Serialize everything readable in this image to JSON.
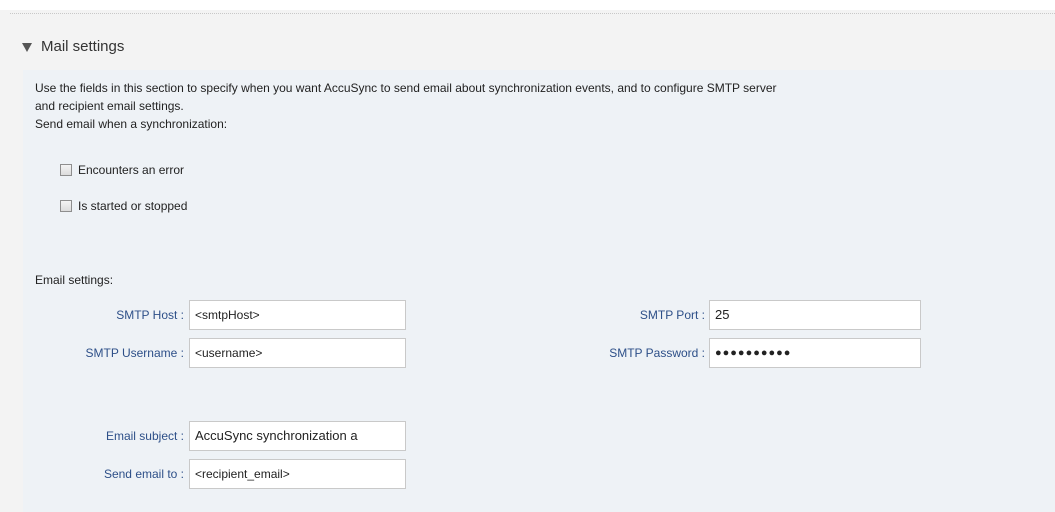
{
  "section": {
    "title": "Mail settings"
  },
  "description": {
    "line1": "Use the fields in this section to specify when you want AccuSync to send email about synchronization events, and to configure SMTP server",
    "line2": "and recipient email settings.",
    "send_when": "Send email when a synchronization:"
  },
  "triggers": [
    {
      "label": "Encounters an error",
      "checked": false
    },
    {
      "label": "Is started or stopped",
      "checked": false
    }
  ],
  "email_settings": {
    "heading": "Email settings:",
    "smtp_host": {
      "label": "SMTP Host :",
      "value": "<smtpHost>"
    },
    "smtp_port": {
      "label": "SMTP Port :",
      "value": "25"
    },
    "smtp_username": {
      "label": "SMTP Username :",
      "value": "<username>"
    },
    "smtp_password": {
      "label": "SMTP Password :",
      "value": "●●●●●●●●●●"
    },
    "email_subject": {
      "label": "Email subject :",
      "value": "AccuSync synchronization a"
    },
    "send_to": {
      "label": "Send email to :",
      "value": "<recipient_email>"
    }
  }
}
